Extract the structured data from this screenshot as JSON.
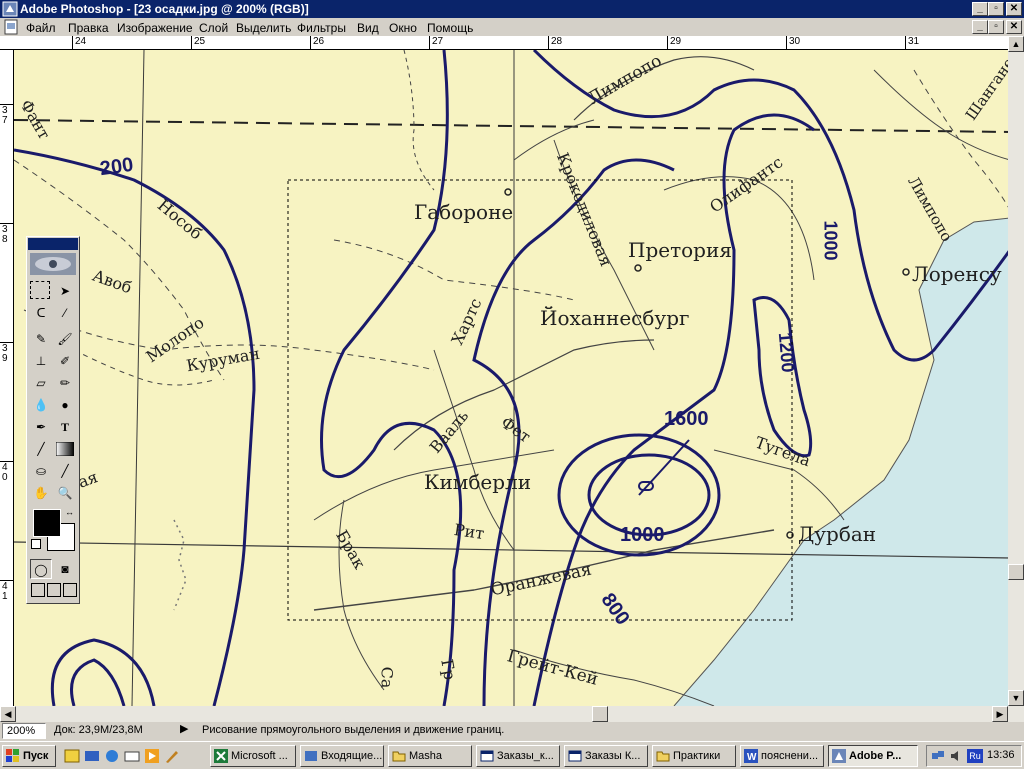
{
  "window": {
    "title": "Adobe Photoshop - [23 осадки.jpg @ 200% (RGB)]",
    "min": "_",
    "restore": "▫",
    "close": "✕"
  },
  "menu": {
    "items": [
      "Файл",
      "Правка",
      "Изображение",
      "Слой",
      "Выделить",
      "Фильтры",
      "Вид",
      "Окно",
      "Помощь"
    ]
  },
  "ruler": {
    "top_labels": [
      "24",
      "25",
      "26",
      "27",
      "28",
      "29",
      "30",
      "31"
    ],
    "left_labels": [
      "3 7",
      "3 8",
      "3 9",
      "4 0",
      "4 1"
    ]
  },
  "map": {
    "cities": [
      "Габороне",
      "Претория",
      "Йоханнесбург",
      "Кимберли",
      "Лоренсу",
      "Дурбан"
    ],
    "rivers": [
      "Лимпопо",
      "Крокодиловая",
      "Олифантс",
      "Шангане",
      "Лимпопо",
      "Нособ",
      "Авоб",
      "Молопо",
      "Куруман",
      "Хартс",
      "Вааль",
      "Фет",
      "Рит",
      "Брак",
      "Оранжевая",
      "Грейт-Кей",
      "Тугела",
      "Фант",
      "ая",
      "Са",
      "Гр"
    ],
    "isohyets": [
      "200",
      "1000",
      "1200",
      "1600",
      "1000",
      "800"
    ]
  },
  "toolbox": {
    "tools": [
      "marquee",
      "move",
      "lasso",
      "magic-wand",
      "airbrush",
      "brush",
      "stamp",
      "history-brush",
      "eraser",
      "pencil",
      "blur",
      "dodge",
      "pen",
      "type",
      "measure",
      "gradient",
      "paint-bucket",
      "eyedropper",
      "hand",
      "zoom"
    ],
    "type_glyph": "T",
    "fg_color": "#000000",
    "bg_color": "#ffffff"
  },
  "status": {
    "zoom": "200%",
    "doc": "Док: 23,9M/23,8M",
    "hint": "Рисование прямоугольного выделения и движение границ."
  },
  "taskbar": {
    "start": "Пуск",
    "buttons": [
      "Microsoft ...",
      "Входящие...",
      "Masha",
      "Заказы_к...",
      "Заказы К...",
      "Практики",
      "пояснени...",
      "Adobe P..."
    ],
    "lang": "Ru",
    "clock": "13:36"
  },
  "colors": {
    "title_bg": "#0a246a",
    "isohyet": "#1a1a6a",
    "map_bg": "#f7f3c2",
    "ocean": "#cfe8ea"
  }
}
